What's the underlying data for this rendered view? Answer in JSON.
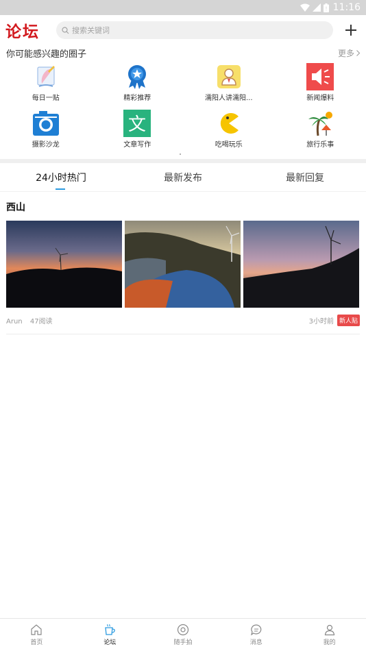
{
  "status_bar": {
    "time": "11:16"
  },
  "header": {
    "logo": "论坛",
    "search_placeholder": "搜索关键词"
  },
  "circles": {
    "title": "你可能感兴趣的圈子",
    "more": "更多",
    "items": [
      {
        "label": "每日一贴",
        "icon": "daily-post-icon"
      },
      {
        "label": "精彩推荐",
        "icon": "recommend-medal-icon"
      },
      {
        "label": "濡阳人讲濡阳...",
        "icon": "person-card-icon"
      },
      {
        "label": "新闻爆料",
        "icon": "megaphone-icon"
      },
      {
        "label": "摄影沙龙",
        "icon": "camera-icon"
      },
      {
        "label": "文章写作",
        "icon": "writing-icon"
      },
      {
        "label": "吃喝玩乐",
        "icon": "pacman-icon"
      },
      {
        "label": "旅行乐事",
        "icon": "palm-tree-icon"
      }
    ]
  },
  "tabs": [
    "24小时热门",
    "最新发布",
    "最新回复"
  ],
  "active_tab": 0,
  "post": {
    "title": "西山",
    "author": "Arun",
    "reads": "47阅读",
    "time": "3小时前",
    "badge": "新人贴"
  },
  "bottom_nav": [
    {
      "label": "首页",
      "icon": "home-icon"
    },
    {
      "label": "论坛",
      "icon": "forum-cup-icon",
      "active": true
    },
    {
      "label": "随手拍",
      "icon": "snap-camera-icon"
    },
    {
      "label": "消息",
      "icon": "message-icon"
    },
    {
      "label": "我的",
      "icon": "profile-icon"
    }
  ],
  "colors": {
    "accent": "#2c9be0",
    "brand": "#d2191e",
    "badge": "#e84a4a"
  }
}
